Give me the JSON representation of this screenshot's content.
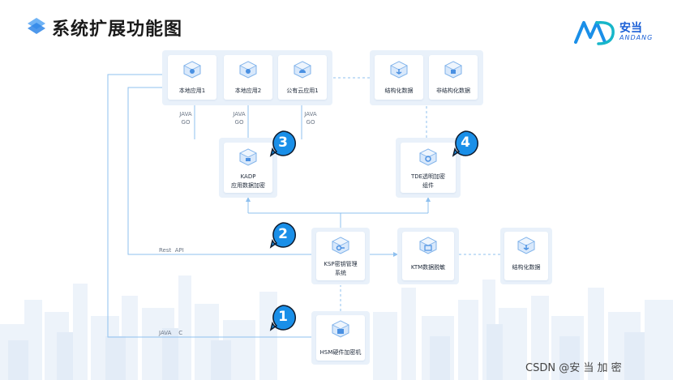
{
  "title": "系统扩展功能图",
  "brand": {
    "name": "安当",
    "sub": "ANDANG"
  },
  "nodes": {
    "local_app_1": "本地应用1",
    "local_app_2": "本地应用2",
    "public_cloud_app_1": "公有云应用1",
    "structured_data_top": "结构化数据",
    "unstructured_data": "非结构化数据",
    "kadp_line1": "KADP",
    "kadp_line2": "应用数据加密",
    "tde_line1": "TDE透明加密",
    "tde_line2": "组件",
    "ksp_line1": "KSP密钥管理",
    "ksp_line2": "系统",
    "ktm": "KTM数据脱敏",
    "structured_data_right": "结构化数据",
    "hsm": "HSM硬件加密机"
  },
  "edge_labels": {
    "java": "JAVA",
    "go": "GO",
    "rest_api": "Rest  API",
    "java_c": "JAVA    C"
  },
  "badges": [
    "1",
    "2",
    "3",
    "4"
  ],
  "watermark": "CSDN @安 当 加 密",
  "colors": {
    "accent": "#1a8fe8",
    "line": "#8fc1ef",
    "panel": "#e9f1fa"
  }
}
